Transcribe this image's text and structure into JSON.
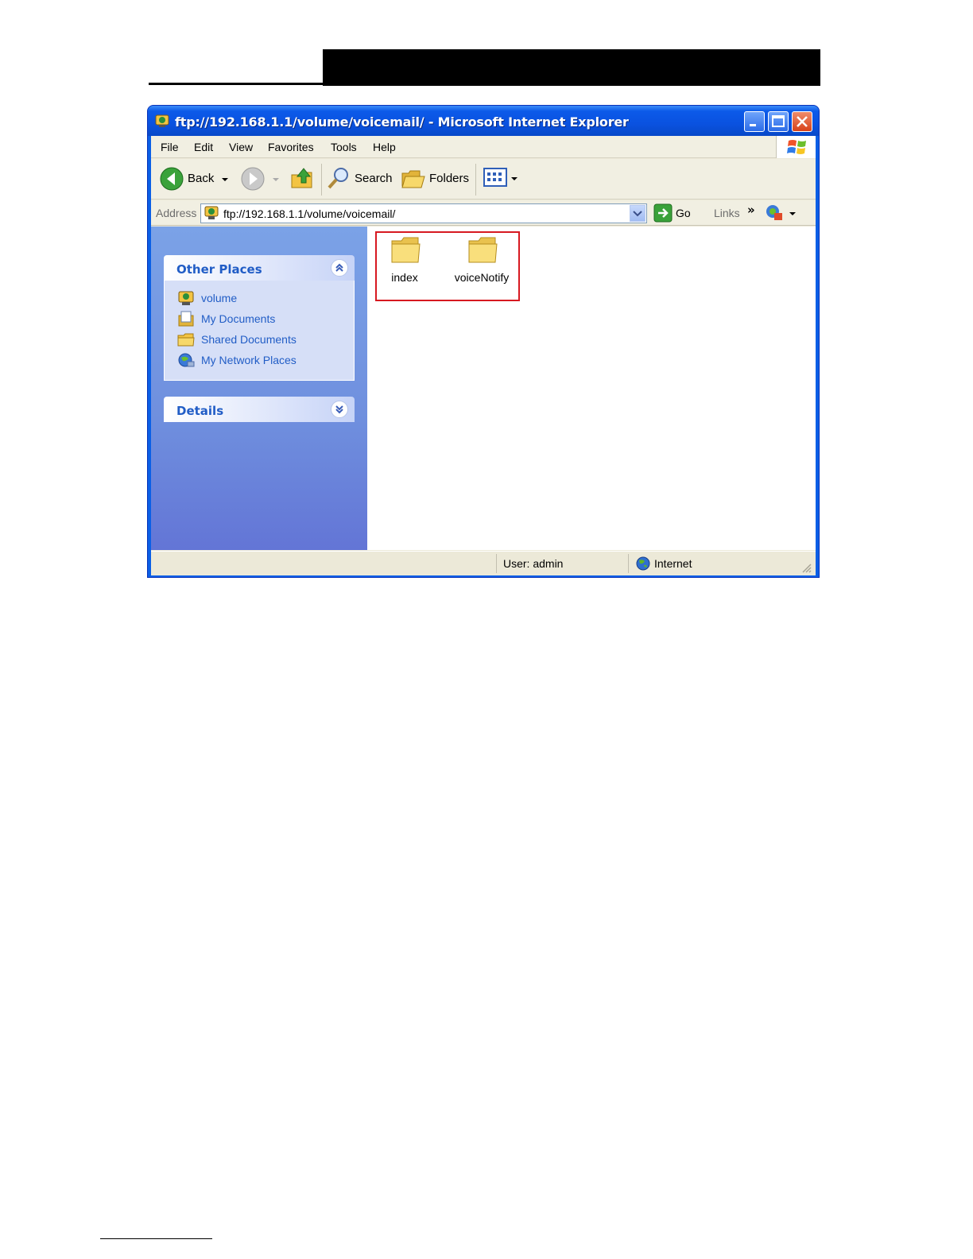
{
  "window": {
    "title": "ftp://192.168.1.1/volume/voicemail/ - Microsoft Internet Explorer"
  },
  "menu": {
    "items": [
      "File",
      "Edit",
      "View",
      "Favorites",
      "Tools",
      "Help"
    ]
  },
  "toolbar": {
    "back_label": "Back",
    "search_label": "Search",
    "folders_label": "Folders"
  },
  "address": {
    "label": "Address",
    "value": "ftp://192.168.1.1/volume/voicemail/",
    "go_label": "Go",
    "links_label": "Links",
    "links_more": "»"
  },
  "taskpane": {
    "other_places": {
      "title": "Other Places",
      "items": [
        {
          "label": "volume",
          "icon": "ftp-folder-icon"
        },
        {
          "label": "My Documents",
          "icon": "my-documents-icon"
        },
        {
          "label": "Shared Documents",
          "icon": "shared-folder-icon"
        },
        {
          "label": "My Network Places",
          "icon": "network-places-icon"
        }
      ]
    },
    "details": {
      "title": "Details"
    }
  },
  "files": [
    {
      "name": "index",
      "icon": "folder-icon"
    },
    {
      "name": "voiceNotify",
      "icon": "folder-icon"
    }
  ],
  "status": {
    "user": "User: admin",
    "zone": "Internet"
  },
  "colors": {
    "title_blue": "#0a52e0",
    "link_blue": "#215dc6",
    "highlight_red": "#d71921"
  }
}
